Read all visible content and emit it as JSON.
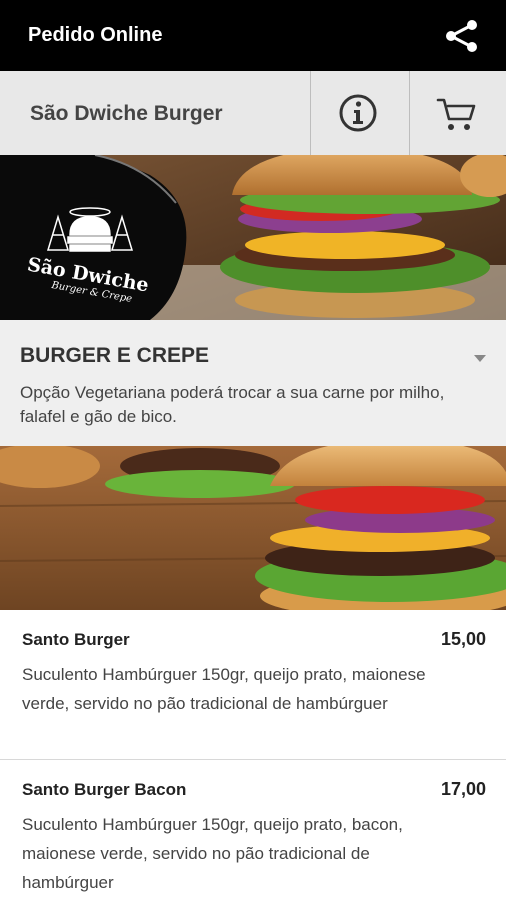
{
  "appbar": {
    "title": "Pedido Online",
    "share_icon": "share-icon"
  },
  "subbar": {
    "store_name": "São Dwiche Burger",
    "info_icon": "info-icon",
    "cart_icon": "cart-icon"
  },
  "logo": {
    "line1": "São Dwiche",
    "line2": "Burger & Crepe"
  },
  "category": {
    "name": "BURGER E CREPE",
    "description": "Opção Vegetariana poderá trocar a sua carne por milho, falafel e gão de bico."
  },
  "items": [
    {
      "name": "Santo Burger",
      "price": "15,00",
      "description": "Suculento Hambúrguer 150gr, queijo prato, maionese verde, servido no pão tradicional de hambúrguer"
    },
    {
      "name": "Santo Burger Bacon",
      "price": "17,00",
      "description": "Suculento Hambúrguer 150gr, queijo prato, bacon, maionese verde, servido no pão tradicional de hambúrguer"
    }
  ],
  "colors": {
    "appbar": "#000000",
    "subbar": "#e8e8e8",
    "category_bg": "#efefef"
  }
}
